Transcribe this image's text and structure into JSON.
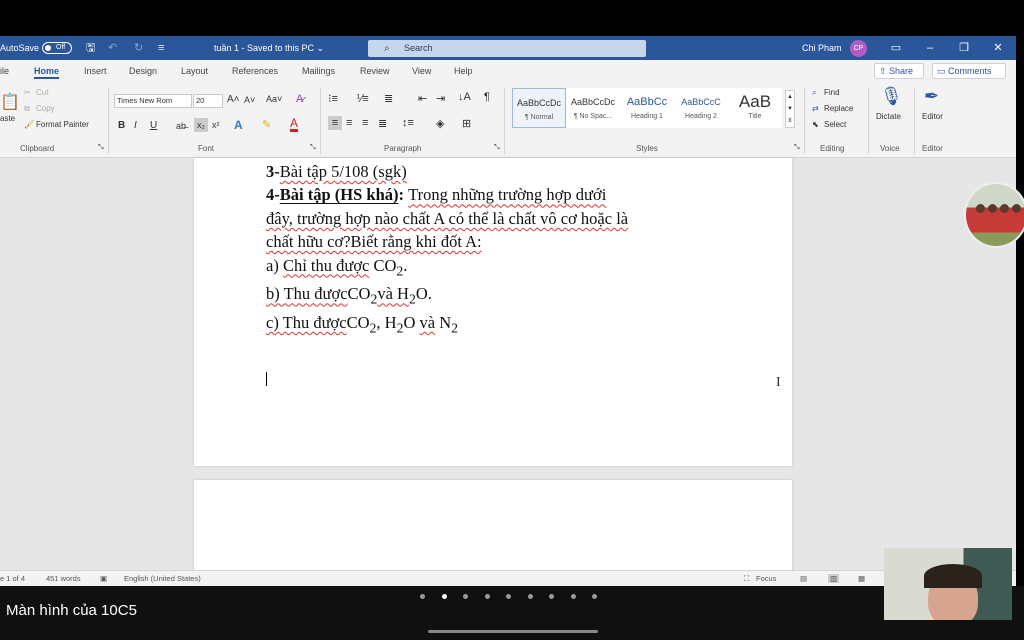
{
  "titlebar": {
    "autosave_label": "AutoSave",
    "autosave_state": "Off",
    "doc_title": "tuần 1 - Saved to this PC ⌄",
    "search_placeholder": "Search",
    "user_name": "Chi Pham",
    "user_initials": "CP"
  },
  "tabs": [
    "ile",
    "Home",
    "Insert",
    "Design",
    "Layout",
    "References",
    "Mailings",
    "Review",
    "View",
    "Help"
  ],
  "active_tab": "Home",
  "share_label": "Share",
  "comments_label": "Comments",
  "ribbon": {
    "clipboard": {
      "paste": "aste",
      "cut": "Cut",
      "copy": "Copy",
      "format_painter": "Format Painter",
      "label": "Clipboard"
    },
    "font": {
      "name": "Times New Rom",
      "size": "20",
      "label": "Font",
      "bold": "B",
      "italic": "I",
      "underline": "U",
      "font_color": "A"
    },
    "paragraph": {
      "label": "Paragraph"
    },
    "styles": {
      "items": [
        {
          "sample": "AaBbCcDc",
          "name": "¶ Normal"
        },
        {
          "sample": "AaBbCcDc",
          "name": "¶ No Spac..."
        },
        {
          "sample": "AaBbCc",
          "name": "Heading 1"
        },
        {
          "sample": "AaBbCcC",
          "name": "Heading 2"
        },
        {
          "sample": "AaB",
          "name": "Title"
        }
      ],
      "label": "Styles"
    },
    "editing": {
      "find": "Find",
      "replace": "Replace",
      "select": "Select",
      "label": "Editing"
    },
    "voice": {
      "dictate": "Dictate",
      "label": "Voice"
    },
    "editor": {
      "editor": "Editor",
      "label": "Editor"
    }
  },
  "document": {
    "line1": {
      "num": "3-",
      "text": "Bài tập 5/108 (sgk)"
    },
    "line2": {
      "num": "4-",
      "head": "Bài tập (HS khá)",
      "colon": ": ",
      "text": "Trong những trường hợp dưới"
    },
    "line3": "đây, trường hợp nào chất A có thể là chất vô cơ hoặc là",
    "line4": "chất hữu cơ?Biết rằng khi đốt A:",
    "item_a": {
      "prefix": "a) ",
      "words": "Chỉ thu được",
      "formula": "CO",
      "sub": "2",
      "end": "."
    },
    "item_b": {
      "prefix": "b) Thu được",
      "f1": "CO",
      "s1": "2",
      "mid": "và H",
      "s2": "2",
      "end": "O."
    },
    "item_c": {
      "prefix": "c) Thu được",
      "f1": "CO",
      "s1": "2",
      "mid": ", H",
      "s2": "2",
      "mid2": "O ",
      "va": "và",
      "n": " N",
      "s3": "2"
    }
  },
  "statusbar": {
    "page": "e 1 of 4",
    "words": "451 words",
    "language": "English (United States)",
    "focus": "Focus"
  },
  "meeting": {
    "screen_label": "Màn hình của 10C5",
    "page_dots": 9,
    "active_dot": 1
  }
}
